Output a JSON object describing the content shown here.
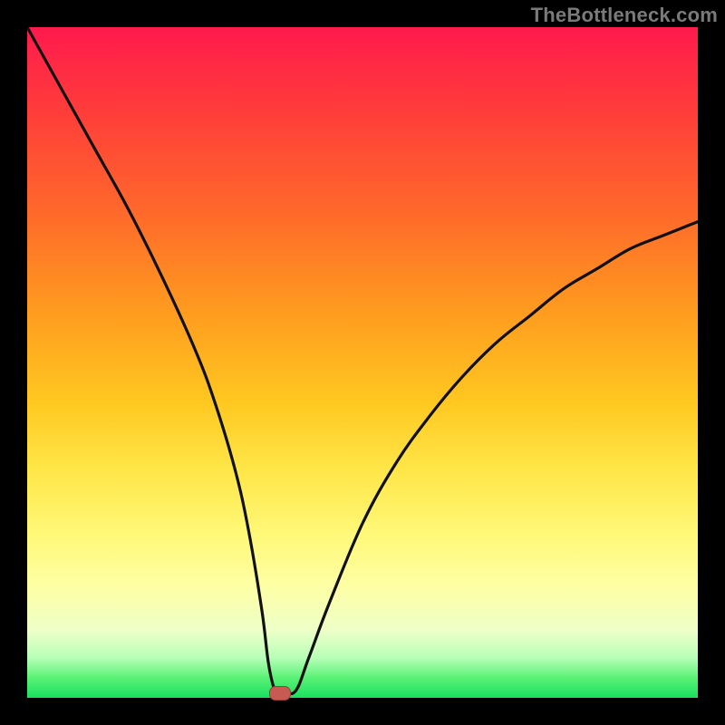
{
  "watermark": "TheBottleneck.com",
  "colors": {
    "frame": "#000000",
    "curve_stroke": "#111111",
    "marker_fill": "#c75a52",
    "marker_border": "#9e3f38"
  },
  "chart_data": {
    "type": "line",
    "title": "",
    "xlabel": "",
    "ylabel": "",
    "xlim": [
      0,
      100
    ],
    "ylim": [
      0,
      100
    ],
    "grid": false,
    "legend": false,
    "series": [
      {
        "name": "bottleneck-curve",
        "x": [
          0,
          5,
          10,
          15,
          20,
          25,
          28,
          31,
          33,
          35,
          36,
          37,
          38,
          40,
          42,
          45,
          50,
          55,
          60,
          65,
          70,
          75,
          80,
          85,
          90,
          95,
          100
        ],
        "values": [
          100,
          91,
          82,
          73,
          63,
          52,
          44,
          34,
          25,
          13,
          5,
          1,
          1,
          1,
          6,
          14,
          26,
          35,
          42,
          48,
          53,
          57,
          61,
          64,
          67,
          69,
          71
        ]
      }
    ],
    "marker": {
      "x": 37.5,
      "y": 0.5
    },
    "gradient_stops": [
      {
        "pct": 0,
        "color": "#ff1a4d"
      },
      {
        "pct": 12,
        "color": "#ff3b3b"
      },
      {
        "pct": 28,
        "color": "#ff6a2a"
      },
      {
        "pct": 42,
        "color": "#ff9a1f"
      },
      {
        "pct": 56,
        "color": "#ffc820"
      },
      {
        "pct": 66,
        "color": "#ffe648"
      },
      {
        "pct": 76,
        "color": "#fff97a"
      },
      {
        "pct": 84,
        "color": "#fdffa8"
      },
      {
        "pct": 90,
        "color": "#edffc8"
      },
      {
        "pct": 94,
        "color": "#b8ffb8"
      },
      {
        "pct": 97,
        "color": "#5bf276"
      },
      {
        "pct": 100,
        "color": "#18e060"
      }
    ]
  }
}
